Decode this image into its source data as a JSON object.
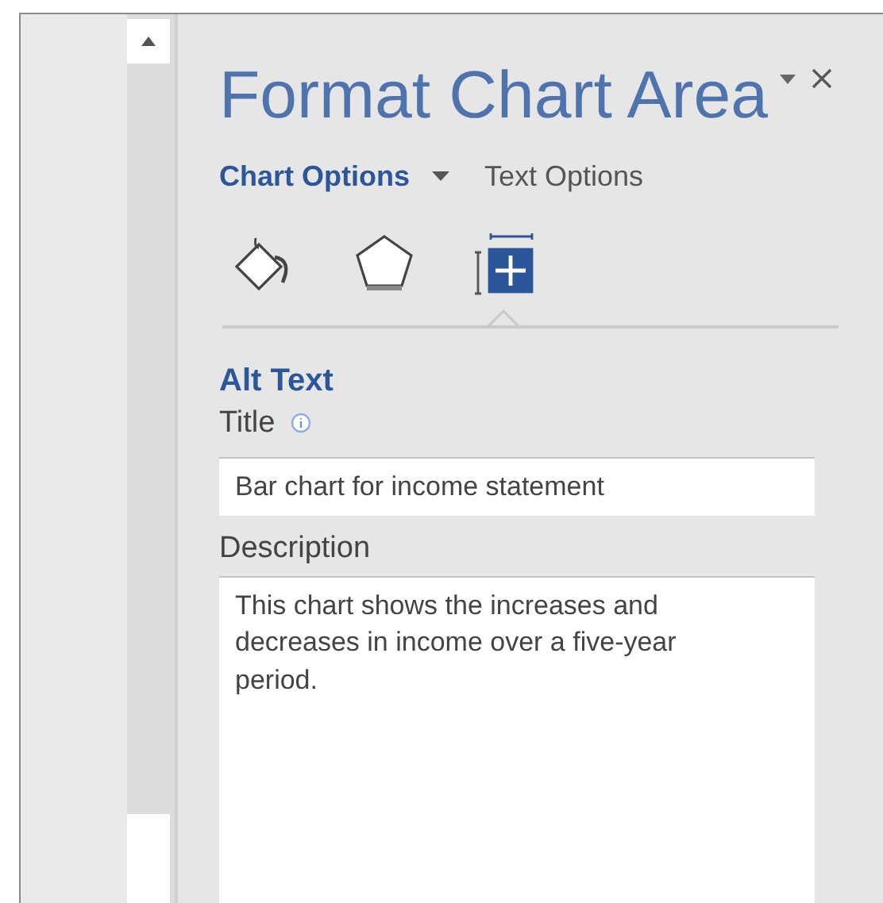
{
  "pane": {
    "title": "Format Chart Area"
  },
  "option_tabs": [
    {
      "label": "Chart Options",
      "selected": true,
      "dropdown": true
    },
    {
      "label": "Text Options",
      "selected": false,
      "dropdown": false
    }
  ],
  "icon_tabs": [
    {
      "kind": "fill",
      "selected": false
    },
    {
      "kind": "effects",
      "selected": false
    },
    {
      "kind": "size",
      "selected": true
    }
  ],
  "section": {
    "heading": "Alt Text",
    "title_field": {
      "label": "Title",
      "info": true,
      "value": "Bar chart for income statement"
    },
    "description_field": {
      "label": "Description",
      "value": "This chart shows the increases and decreases in income over a five-year period."
    }
  }
}
